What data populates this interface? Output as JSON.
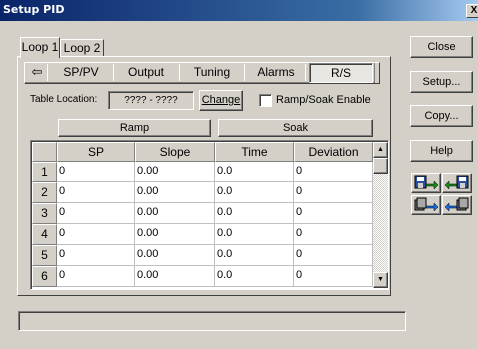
{
  "window": {
    "title": "Setup PID",
    "close_glyph": "X"
  },
  "loop_tabs": [
    {
      "label": "Loop 1"
    },
    {
      "label": "Loop 2"
    }
  ],
  "inner_tabs": {
    "back_icon": "⇦",
    "items": [
      {
        "label": "SP/PV"
      },
      {
        "label": "Output"
      },
      {
        "label": "Tuning"
      },
      {
        "label": "Alarms"
      },
      {
        "label": "R/S"
      }
    ],
    "selected": "R/S"
  },
  "table_location": {
    "label": "Table Location:",
    "value": "???? - ????",
    "change_button": "Change"
  },
  "ramp_soak": {
    "label": "Ramp/Soak Enable",
    "checked": false
  },
  "grid": {
    "groups": [
      {
        "label": "Ramp"
      },
      {
        "label": "Soak"
      }
    ],
    "columns": [
      {
        "label": "SP"
      },
      {
        "label": "Slope"
      },
      {
        "label": "Time"
      },
      {
        "label": "Deviation"
      }
    ],
    "rows": [
      {
        "num": "1",
        "cells": [
          "0",
          "0.00",
          "0.0",
          "0"
        ]
      },
      {
        "num": "2",
        "cells": [
          "0",
          "0.00",
          "0.0",
          "0"
        ]
      },
      {
        "num": "3",
        "cells": [
          "0",
          "0.00",
          "0.0",
          "0"
        ]
      },
      {
        "num": "4",
        "cells": [
          "0",
          "0.00",
          "0.0",
          "0"
        ]
      },
      {
        "num": "5",
        "cells": [
          "0",
          "0.00",
          "0.0",
          "0"
        ]
      },
      {
        "num": "6",
        "cells": [
          "0",
          "0.00",
          "0.0",
          "0"
        ]
      }
    ],
    "scroll_up": "▲",
    "scroll_down": "▼"
  },
  "buttons": {
    "close": "Close",
    "setup": "Setup...",
    "copy": "Copy...",
    "help": "Help"
  },
  "icon_buttons": [
    {
      "name": "plc-to-disk-icon"
    },
    {
      "name": "disk-to-plc-icon"
    },
    {
      "name": "plc-to-memory-icon"
    },
    {
      "name": "memory-to-plc-icon"
    }
  ],
  "status_bar": {
    "text": ""
  }
}
